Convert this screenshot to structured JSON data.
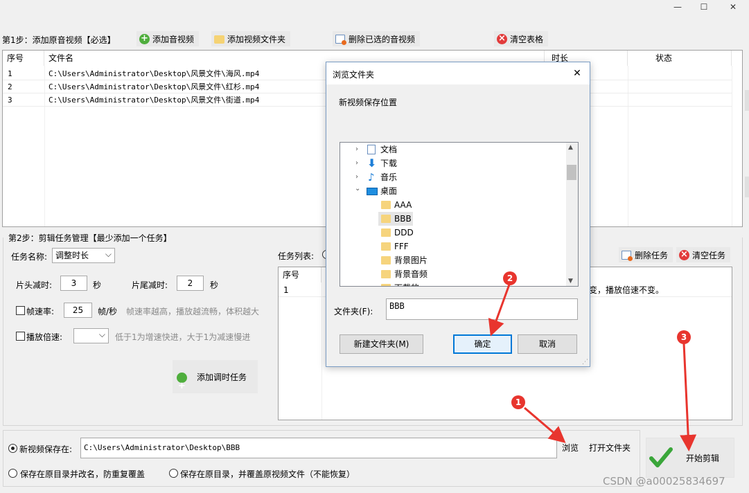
{
  "window": {
    "minimize": "—",
    "maximize": "☐",
    "close": "✕"
  },
  "step1": {
    "label": "第1步：添加原音视频【必选】",
    "add_av": "添加音视频",
    "add_folder": "添加视频文件夹",
    "delete_selected": "删除已选的音视频",
    "clear_table": "清空表格",
    "columns": [
      "序号",
      "文件名",
      "时长",
      "状态"
    ],
    "rows": [
      {
        "no": "1",
        "file": "C:\\Users\\Administrator\\Desktop\\风景文件\\海风.mp4"
      },
      {
        "no": "2",
        "file": "C:\\Users\\Administrator\\Desktop\\风景文件\\红杉.mp4"
      },
      {
        "no": "3",
        "file": "C:\\Users\\Administrator\\Desktop\\风景文件\\街道.mp4"
      }
    ]
  },
  "step2": {
    "label": "第2步：剪辑任务管理【最少添加一个任务】",
    "task_name_label": "任务名称:",
    "task_name_value": "调整时长",
    "head_cut_label": "片头减时:",
    "head_cut_value": "3",
    "tail_cut_label": "片尾减时:",
    "tail_cut_value": "2",
    "sec": "秒",
    "framerate_label": "帧速率:",
    "framerate_value": "25",
    "framerate_unit": "帧/秒",
    "framerate_hint": "帧速率越高，播放越流畅，体积越大",
    "speed_label": "播放倍速:",
    "speed_value": "",
    "speed_hint": "低于1为增速快进，大于1为减速慢进",
    "add_task": "添加调时任务",
    "task_list_label": "任务列表:",
    "delete_task": "删除任务",
    "clear_tasks": "清空任务",
    "task_col_no": "序号",
    "task_row_no": "1",
    "task_row_desc": "变，播放倍速不变。"
  },
  "output": {
    "save_to_label": "新视频保存在:",
    "save_path": "C:\\Users\\Administrator\\Desktop\\BBB",
    "browse": "浏览",
    "open_folder": "打开文件夹",
    "opt_rename": "保存在原目录并改名，防重复覆盖",
    "opt_overwrite": "保存在原目录，并覆盖原视频文件（不能恢复）",
    "start": "开始剪辑"
  },
  "dialog": {
    "title": "浏览文件夹",
    "subtitle": "新视频保存位置",
    "tree": [
      {
        "label": "文档",
        "level": 0,
        "arrow": "›",
        "icon": "document-icon"
      },
      {
        "label": "下载",
        "level": 0,
        "arrow": "›",
        "icon": "download-icon"
      },
      {
        "label": "音乐",
        "level": 0,
        "arrow": "›",
        "icon": "music-icon"
      },
      {
        "label": "桌面",
        "level": 0,
        "arrow": "⌄",
        "icon": "desktop-icon"
      },
      {
        "label": "AAA",
        "level": 1
      },
      {
        "label": "BBB",
        "level": 1,
        "selected": true
      },
      {
        "label": "DDD",
        "level": 1
      },
      {
        "label": "FFF",
        "level": 1
      },
      {
        "label": "背景图片",
        "level": 1
      },
      {
        "label": "背景音频",
        "level": 1
      },
      {
        "label": "下载的",
        "level": 1
      }
    ],
    "folder_label": "文件夹(F):",
    "folder_value": "BBB",
    "new_folder": "新建文件夹(M)",
    "ok": "确定",
    "cancel": "取消"
  },
  "markers": [
    "1",
    "2",
    "3"
  ],
  "watermark": "CSDN @a00025834697",
  "colors": {
    "marker": "#e8352e",
    "accent": "#0078d7",
    "check": "#3aa63a"
  }
}
